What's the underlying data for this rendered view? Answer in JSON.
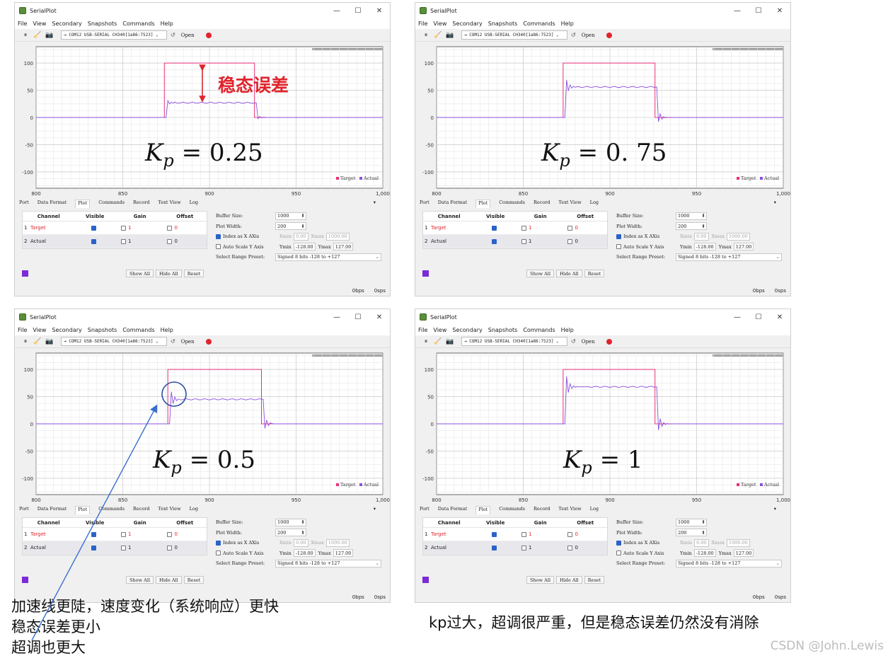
{
  "windows": [
    {
      "title": "SerialPlot",
      "kp_label": "0.25",
      "captures": {
        "shape": "rise-low"
      }
    },
    {
      "title": "SerialPlot",
      "kp_label": "0. 75",
      "captures": {
        "shape": "high"
      }
    },
    {
      "title": "SerialPlot",
      "kp_label": "0.5",
      "captures": {
        "shape": "mid"
      }
    },
    {
      "title": "SerialPlot",
      "kp_label": "1",
      "captures": {
        "shape": "very-high"
      }
    }
  ],
  "window_controls": {
    "minimize": "—",
    "maximize": "☐",
    "close": "✕"
  },
  "menu": [
    "File",
    "View",
    "Secondary",
    "Snapshots",
    "Commands",
    "Help"
  ],
  "toolbar": {
    "port": "⇥ COM12 USB-SERIAL CH340[1a86:7523] ⌄",
    "refresh": "↺",
    "open": "Open",
    "icons": [
      "pause-icon",
      "broom-icon",
      "camera-icon"
    ]
  },
  "plot": {
    "y_ticks": [
      "100",
      "50",
      "0",
      "-50",
      "-100"
    ],
    "x_ticks": [
      "800",
      "850",
      "900",
      "950",
      "1,000"
    ],
    "legend_target": "Target",
    "legend_actual": "Actual",
    "colors": {
      "target": "#e8307a",
      "actual": "#8a4fe0"
    }
  },
  "tabs": [
    "Port",
    "Data Format",
    "Plot",
    "Commands",
    "Record",
    "Text View",
    "Log"
  ],
  "active_tab": "Plot",
  "channels": {
    "headers": [
      "Channel",
      "Visible",
      "Gain",
      "Offset"
    ],
    "rows": [
      {
        "num": "1",
        "name": "Target",
        "gain": "1",
        "offset": "0"
      },
      {
        "num": "2",
        "name": "Actual",
        "gain": "1",
        "offset": "0"
      }
    ]
  },
  "channel_buttons": [
    "Show All",
    "Hide All",
    "Reset"
  ],
  "settings": {
    "buffer_label": "Buffer Size:",
    "buffer_value": "1000",
    "width_label": "Plot Width:",
    "width_value": "200",
    "index_label": "Index as X AXis",
    "xmin_label": "Xmin",
    "xmin_value": "0.00",
    "xmax_label": "Xmax",
    "xmax_value": "1000.00",
    "autoscale_label": "Auto Scale Y Axis",
    "ymin_label": "Ymin",
    "ymin_value": "-128.00",
    "ymax_label": "Ymax",
    "ymax_value": "127.00",
    "preset_label": "Select Range Preset:",
    "preset_value": "Signed 8 bits -128 to +127"
  },
  "status": {
    "left": "0bps",
    "right": "0sps"
  },
  "annotations": {
    "steady_state_error": "稳态误差",
    "caption_left": [
      "加速线更陡，速度变化（系统响应）更快",
      "稳态误差更小",
      "超调也更大"
    ],
    "caption_right": "kp过大，超调很严重，但是稳态误差仍然没有消除",
    "watermark": "CSDN @John.Lewis"
  }
}
